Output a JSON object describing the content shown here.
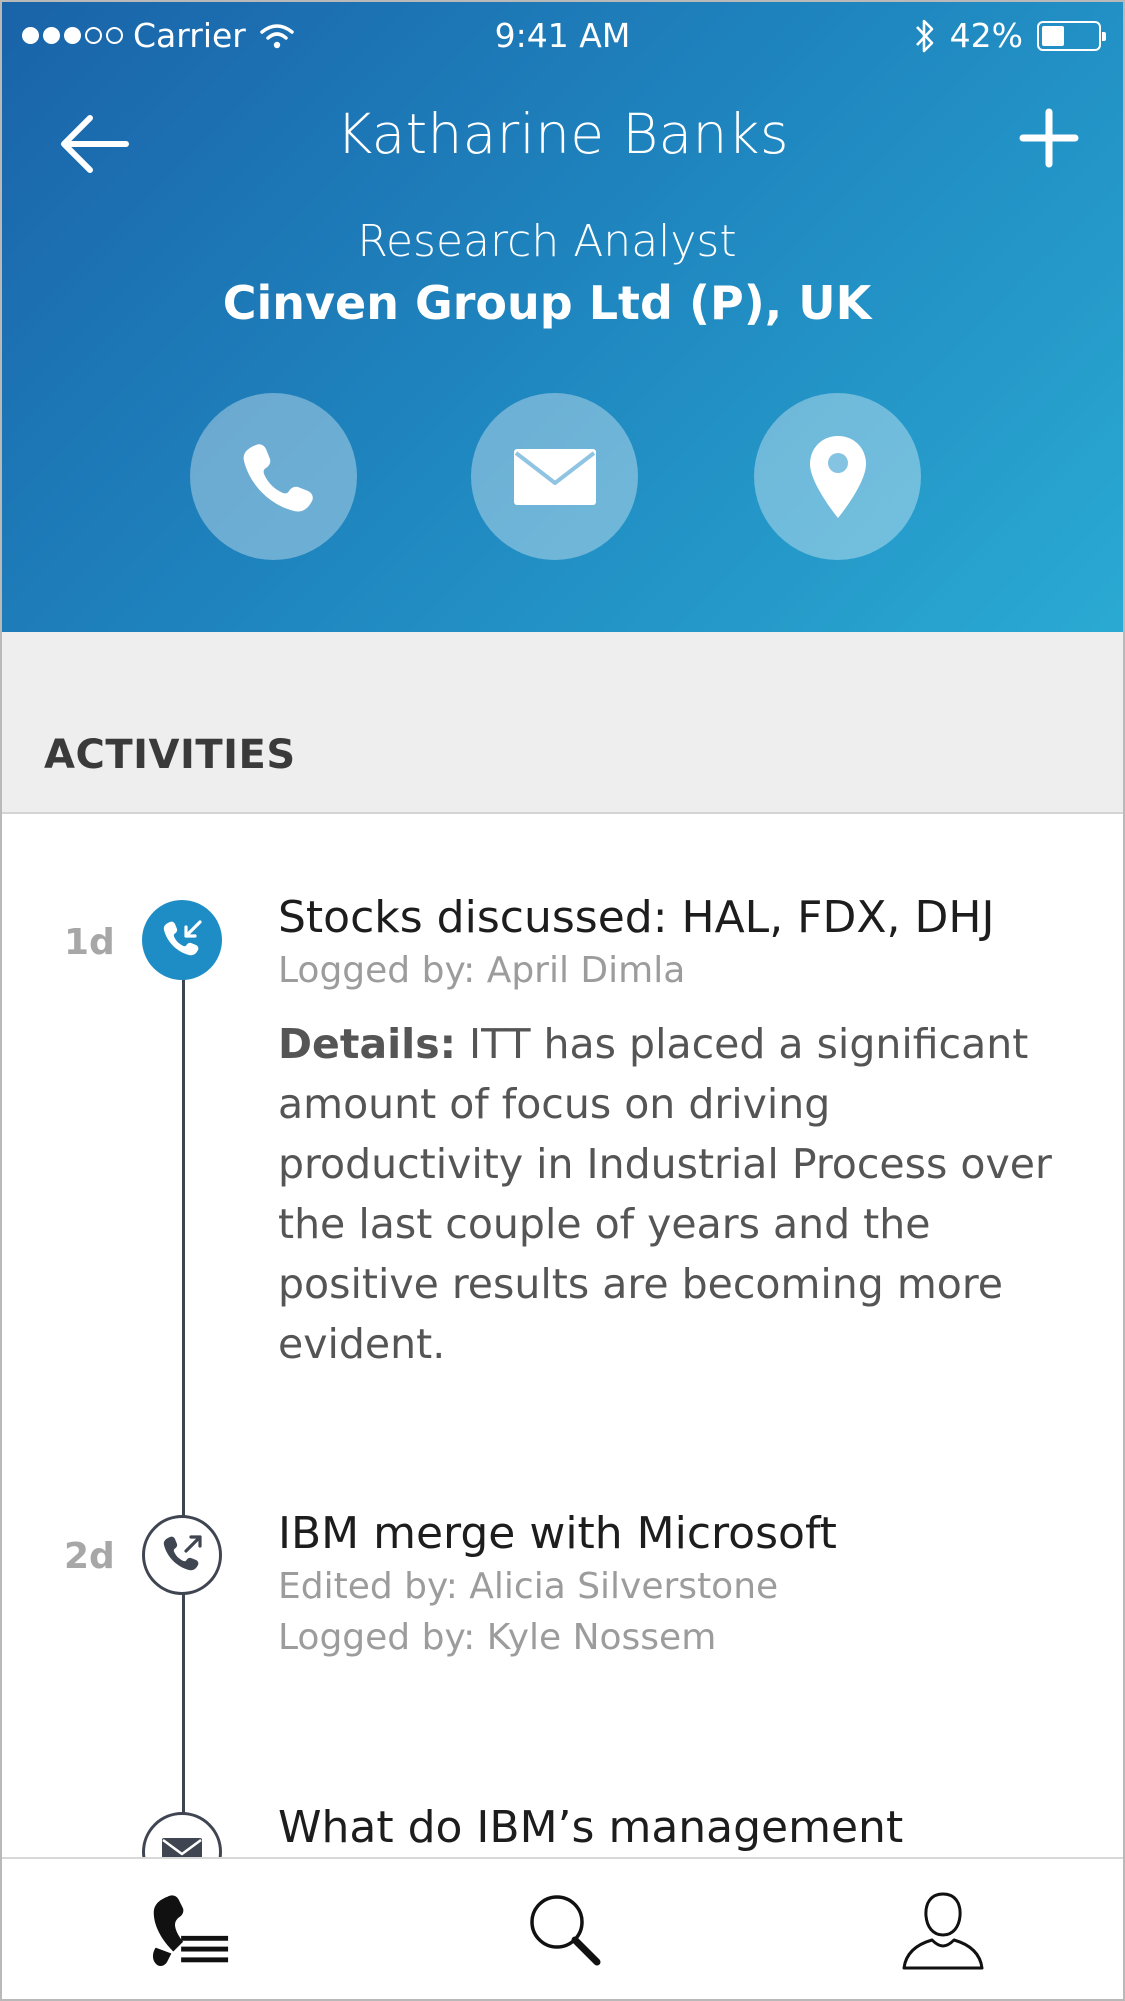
{
  "status_bar": {
    "carrier": "Carrier",
    "time": "9:41 AM",
    "battery_text": "42%",
    "battery_level": 0.42,
    "signal_bars_filled": 3,
    "signal_bars_total": 5
  },
  "header": {
    "name": "Katharine Banks",
    "role": "Research Analyst",
    "company": "Cinven Group Ltd (P), UK",
    "accent_color": "#1f8dc5"
  },
  "actions": {
    "call_icon": "phone-icon",
    "mail_icon": "envelope-icon",
    "location_icon": "map-pin-icon"
  },
  "section": {
    "title": "ACTIVITIES"
  },
  "activities": [
    {
      "age": "1d",
      "icon": "incoming-call-icon",
      "title": "Stocks discussed: HAL, FDX, DHJ",
      "logged_by": "Logged by: April Dimla",
      "details_label": "Details:",
      "details_text": " ITT has placed a significant amount of focus on driving productivity in Industrial Process over the last couple of years and the positive results are becoming more evident."
    },
    {
      "age": "2d",
      "icon": "outgoing-call-icon",
      "title": "IBM merge with Microsoft",
      "edited_by": "Edited by: Alicia Silverstone",
      "logged_by": "Logged by: Kyle Nossem"
    },
    {
      "icon": "envelope-icon",
      "title": "What do IBM’s management"
    }
  ],
  "tabbar": {
    "active_tab": "calls",
    "tabs": [
      "calls-list-icon",
      "search-icon",
      "profile-icon"
    ]
  }
}
